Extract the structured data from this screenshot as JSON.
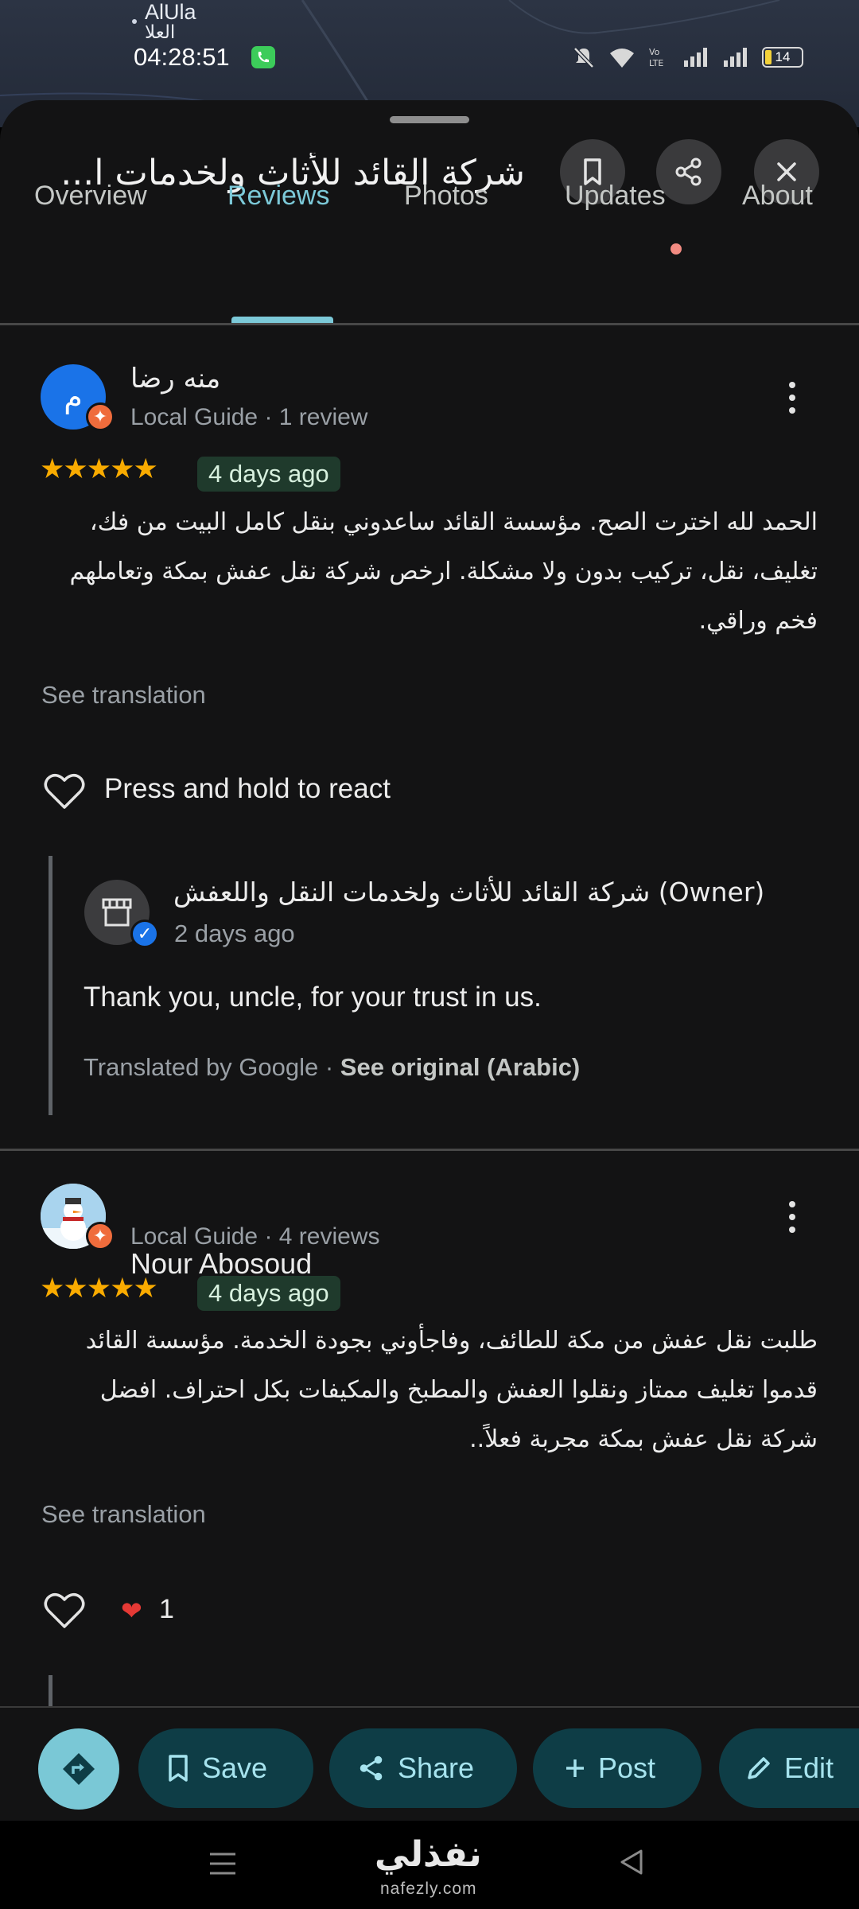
{
  "status_bar": {
    "location_en": "AlUla",
    "location_ar": "العلا",
    "time": "04:28:51",
    "battery": "14"
  },
  "header": {
    "title": "شركة القائد للأثاث ولخدمات ا..."
  },
  "tabs": [
    {
      "label": "Overview"
    },
    {
      "label": "Reviews"
    },
    {
      "label": "Photos"
    },
    {
      "label": "Updates"
    },
    {
      "label": "About"
    }
  ],
  "active_tab": "Reviews",
  "reviews": [
    {
      "avatar_letter": "م",
      "avatar_color": "#1a73e8",
      "name": "منه رضا",
      "meta": "Local Guide · 1 review",
      "rating": 5,
      "stars": "★★★★★",
      "age": "4 days ago",
      "text": "الحمد لله اخترت الصح. مؤسسة القائد ساعدوني بنقل كامل البيت من فك، تغليف، نقل، تركيب بدون ولا مشكلة. ارخص شركة نقل عفش بمكة وتعاملهم فخم وراقي.",
      "see_translation": "See translation",
      "react_prompt": "Press and hold to react",
      "owner_reply": {
        "name": "شركة القائد للأثاث ولخدمات النقل واللعفش (Owner)",
        "age": "2 days ago",
        "text": "Thank you, uncle, for your trust in us.",
        "translated_by": "Translated by Google · ",
        "see_original": "See original (Arabic)"
      }
    },
    {
      "name": "Nour Abosoud",
      "meta": "Local Guide · 4 reviews",
      "rating": 5,
      "stars": "★★★★★",
      "age": "4 days ago",
      "text": "طلبت نقل عفش من مكة للطائف، وفاجأوني بجودة الخدمة. مؤسسة القائد قدموا تغليف ممتاز ونقلوا العفش والمطبخ والمكيفات بكل احتراف. افضل شركة نقل عفش بمكة مجربة فعلاً..",
      "see_translation": "See translation",
      "reaction_count": "1"
    }
  ],
  "actions": {
    "save": "Save",
    "share": "Share",
    "post": "Post",
    "edit": "Edit"
  },
  "watermark": {
    "brand_ar": "نفذلي",
    "brand_url": "nafezly.com"
  },
  "colors": {
    "accent": "#7cc9d8",
    "star": "#f9ab00",
    "pill_bg": "#0e3d46",
    "sheet_bg": "#131314",
    "local_guide_badge": "#ef6c3c"
  }
}
